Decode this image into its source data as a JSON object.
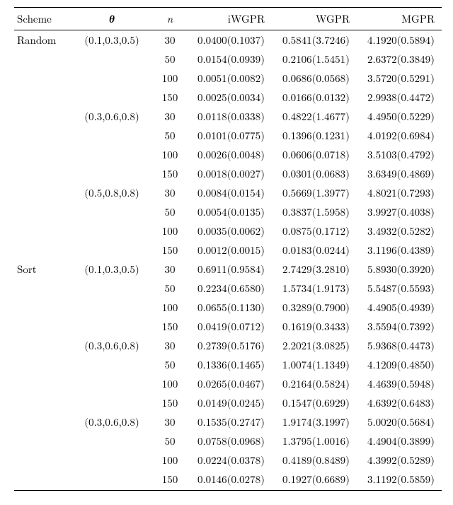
{
  "chart_data": {
    "type": "table",
    "title": "",
    "columns": [
      "Scheme",
      "θ",
      "n",
      "iWGPR",
      "WGPR",
      "MGPR"
    ],
    "header": {
      "scheme": "Scheme",
      "theta": "θ",
      "n": "n",
      "iwgpr": "iWGPR",
      "wgpr": "WGPR",
      "mgpr": "MGPR"
    },
    "groups": [
      {
        "scheme": "Random",
        "blocks": [
          {
            "theta": "(0.1,0.3,0.5)",
            "rows": [
              {
                "n": "30",
                "iwgpr": "0.0400(0.1037)",
                "wgpr": "0.5841(3.7246)",
                "mgpr": "4.1920(0.5894)"
              },
              {
                "n": "50",
                "iwgpr": "0.0154(0.0939)",
                "wgpr": "0.2106(1.5451)",
                "mgpr": "2.6372(0.3849)"
              },
              {
                "n": "100",
                "iwgpr": "0.0051(0.0082)",
                "wgpr": "0.0686(0.0568)",
                "mgpr": "3.5720(0.5291)"
              },
              {
                "n": "150",
                "iwgpr": "0.0025(0.0034)",
                "wgpr": "0.0166(0.0132)",
                "mgpr": "2.9938(0.4472)"
              }
            ]
          },
          {
            "theta": "(0.3,0.6,0.8)",
            "rows": [
              {
                "n": "30",
                "iwgpr": "0.0118(0.0338)",
                "wgpr": "0.4822(1.4677)",
                "mgpr": "4.4950(0.5229)"
              },
              {
                "n": "50",
                "iwgpr": "0.0101(0.0775)",
                "wgpr": "0.1396(0.1231)",
                "mgpr": "4.0192(0.6984)"
              },
              {
                "n": "100",
                "iwgpr": "0.0026(0.0048)",
                "wgpr": "0.0606(0.0718)",
                "mgpr": "3.5103(0.4792)"
              },
              {
                "n": "150",
                "iwgpr": "0.0018(0.0027)",
                "wgpr": "0.0301(0.0683)",
                "mgpr": "3.6349(0.4869)"
              }
            ]
          },
          {
            "theta": "(0.5,0.8,0.8)",
            "rows": [
              {
                "n": "30",
                "iwgpr": "0.0084(0.0154)",
                "wgpr": "0.5669(1.3977)",
                "mgpr": "4.8021(0.7293)"
              },
              {
                "n": "50",
                "iwgpr": "0.0054(0.0135)",
                "wgpr": "0.3837(1.5958)",
                "mgpr": "3.9927(0.4038)"
              },
              {
                "n": "100",
                "iwgpr": "0.0035(0.0062)",
                "wgpr": "0.0875(0.1712)",
                "mgpr": "3.4932(0.5282)"
              },
              {
                "n": "150",
                "iwgpr": "0.0012(0.0015)",
                "wgpr": "0.0183(0.0244)",
                "mgpr": "3.1196(0.4389)"
              }
            ]
          }
        ]
      },
      {
        "scheme": "Sort",
        "blocks": [
          {
            "theta": "(0.1,0.3,0.5)",
            "rows": [
              {
                "n": "30",
                "iwgpr": "0.6911(0.9584)",
                "wgpr": "2.7429(3.2810)",
                "mgpr": "5.8930(0.3920)"
              },
              {
                "n": "50",
                "iwgpr": "0.2234(0.6580)",
                "wgpr": "1.5734(1.9173)",
                "mgpr": "5.5487(0.5593)"
              },
              {
                "n": "100",
                "iwgpr": "0.0655(0.1130)",
                "wgpr": "0.3289(0.7900)",
                "mgpr": "4.4905(0.4939)"
              },
              {
                "n": "150",
                "iwgpr": "0.0419(0.0712)",
                "wgpr": "0.1619(0.3433)",
                "mgpr": "3.5594(0.7392)"
              }
            ]
          },
          {
            "theta": "(0.3,0.6,0.8)",
            "rows": [
              {
                "n": "30",
                "iwgpr": "0.2739(0.5176)",
                "wgpr": "2.2021(3.0825)",
                "mgpr": "5.9368(0.4473)"
              },
              {
                "n": "50",
                "iwgpr": "0.1336(0.1465)",
                "wgpr": "1.0074(1.1349)",
                "mgpr": "4.1209(0.4850)"
              },
              {
                "n": "100",
                "iwgpr": "0.0265(0.0467)",
                "wgpr": "0.2164(0.5824)",
                "mgpr": "4.4639(0.5948)"
              },
              {
                "n": "150",
                "iwgpr": "0.0149(0.0245)",
                "wgpr": "0.1547(0.6929)",
                "mgpr": "4.6392(0.6483)"
              }
            ]
          },
          {
            "theta": "(0.3,0.6,0.8)",
            "rows": [
              {
                "n": "30",
                "iwgpr": "0.1535(0.2747)",
                "wgpr": "1.9174(3.1997)",
                "mgpr": "5.0020(0.5684)"
              },
              {
                "n": "50",
                "iwgpr": "0.0758(0.0968)",
                "wgpr": "1.3795(1.0016)",
                "mgpr": "4.4904(0.3899)"
              },
              {
                "n": "100",
                "iwgpr": "0.0224(0.0378)",
                "wgpr": "0.4189(0.8489)",
                "mgpr": "4.3992(0.5289)"
              },
              {
                "n": "150",
                "iwgpr": "0.0146(0.0278)",
                "wgpr": "0.1927(0.6689)",
                "mgpr": "3.1192(0.5859)"
              }
            ]
          }
        ]
      }
    ]
  }
}
